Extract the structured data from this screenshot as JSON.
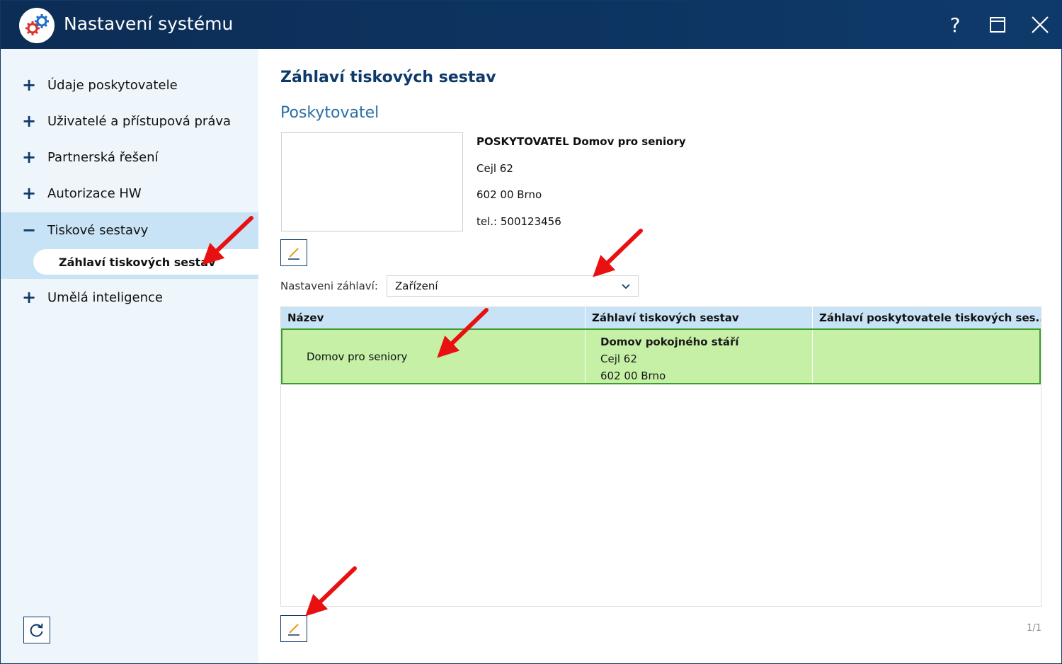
{
  "window": {
    "title": "Nastavení systému",
    "buttons": {
      "help": "?",
      "maximize": "maximize-icon",
      "close": "close-icon"
    }
  },
  "sidebar": {
    "items": [
      {
        "symbol": "+",
        "label": "Údaje poskytovatele"
      },
      {
        "symbol": "+",
        "label": "Uživatelé a přístupová práva"
      },
      {
        "symbol": "+",
        "label": "Partnerská řešení"
      },
      {
        "symbol": "+",
        "label": "Autorizace HW"
      },
      {
        "symbol": "−",
        "label": "Tiskové sestavy",
        "expanded": true,
        "children": [
          {
            "label": "Záhlaví tiskových sestav",
            "selected": true
          }
        ]
      },
      {
        "symbol": "+",
        "label": "Umělá inteligence"
      }
    ],
    "refresh_icon": "refresh-icon"
  },
  "main": {
    "title": "Záhlaví tiskových sestav",
    "section": "Poskytovatel",
    "provider": {
      "name": "POSKYTOVATEL Domov pro seniory",
      "street": "Cejl 62",
      "city": "602 00 Brno",
      "phone": "tel.: 500123456"
    },
    "setting": {
      "label": "Nastaveni záhlaví:",
      "value": "Zařízení"
    },
    "table": {
      "columns": [
        "Název",
        "Záhlaví tiskových sestav",
        "Záhlaví poskytovatele tiskových ses..."
      ],
      "rows": [
        {
          "name": "Domov pro seniory",
          "header_lines": [
            "Domov pokojného stáří",
            "Cejl 62",
            "602 00 Brno"
          ],
          "provider_header": "",
          "selected": true
        }
      ]
    },
    "pager": "1/1"
  },
  "colors": {
    "titlebar": "#0e3a6b",
    "sidebar_bg": "#eef6fc",
    "accent": "#0e3a6b",
    "header_bg": "#c7e3f5",
    "row_selected": "#c6f0a6",
    "row_border": "#3e9b2f",
    "annotation_arrow": "#e81010"
  }
}
